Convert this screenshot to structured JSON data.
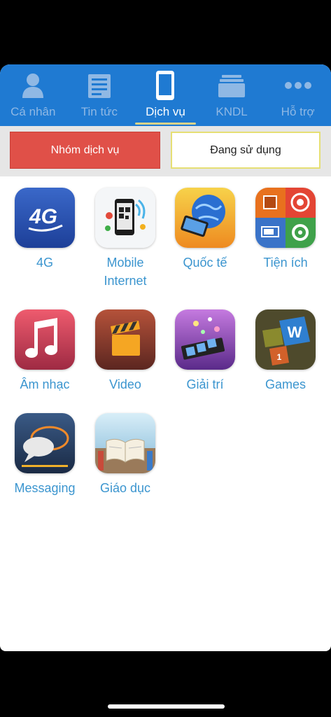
{
  "tabs": [
    {
      "label": "Cá nhân",
      "icon": "person-icon"
    },
    {
      "label": "Tin tức",
      "icon": "news-icon"
    },
    {
      "label": "Dịch vụ",
      "icon": "phone-icon",
      "active": true
    },
    {
      "label": "KNDL",
      "icon": "folder-icon"
    },
    {
      "label": "Hỗ trợ",
      "icon": "more-dots-icon"
    }
  ],
  "segments": {
    "groups_label": "Nhóm dịch vụ",
    "in_use_label": "Đang sử dụng"
  },
  "services": [
    {
      "name": "4G",
      "icon": "4g-icon"
    },
    {
      "name": "Mobile Internet",
      "icon": "mobile-internet-icon"
    },
    {
      "name": "Quốc tế",
      "icon": "international-icon"
    },
    {
      "name": "Tiện ích",
      "icon": "utilities-icon"
    },
    {
      "name": "Âm nhạc",
      "icon": "music-note-icon"
    },
    {
      "name": "Video",
      "icon": "clapperboard-icon"
    },
    {
      "name": "Giải trí",
      "icon": "entertainment-icon"
    },
    {
      "name": "Games",
      "icon": "games-icon"
    },
    {
      "name": "Messaging",
      "icon": "chat-bubbles-icon"
    },
    {
      "name": "Giáo dục",
      "icon": "book-icon"
    }
  ],
  "colors": {
    "nav_bg": "#1f7ad2",
    "accent_red": "#e05048",
    "link_blue": "#3b95cf"
  }
}
